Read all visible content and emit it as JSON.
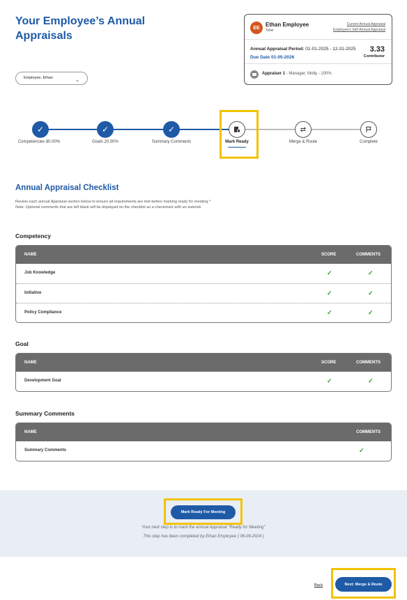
{
  "page": {
    "title": "Your Employee’s Annual Appraisals"
  },
  "employee": {
    "initials": "EE",
    "name": "Ethan Employee",
    "role": "Teller",
    "link_current": "Current Annual Appraisal",
    "link_self": "Employee’s Self-Annual Appraisal",
    "period_label": "Annual Appraisal Period:",
    "period_value": "01-01-2025 - 12-31-2025",
    "due": "Due Date 01-05-2026",
    "score": "3.33",
    "score_label": "Contributor",
    "appraiser_label": "Appraiser 1",
    "appraiser_value": " - Manager, Molly - 100%"
  },
  "employee_select": {
    "value": "Employee, Ethan"
  },
  "stepper": {
    "steps": [
      {
        "label": "Competencies 80.00%",
        "state": "done"
      },
      {
        "label": "Goals 20.00%",
        "state": "done"
      },
      {
        "label": "Summary Comments",
        "state": "done"
      },
      {
        "label": "Mark Ready",
        "state": "active"
      },
      {
        "label": "Merge & Route",
        "state": "upcoming"
      },
      {
        "label": "Complete",
        "state": "upcoming"
      }
    ]
  },
  "checklist": {
    "title": "Annual Appraisal Checklist",
    "description": "Review each annual Appraisal section below to ensure all requirements are met before marking ready for meeting.*",
    "note": "Note: Optional comments that are left blank will be displayed on the checklist as a checkmark with an asterisk."
  },
  "competency": {
    "title": "Competency",
    "headers": {
      "name": "NAME",
      "score": "SCORE",
      "comments": "COMMENTS"
    },
    "rows": [
      {
        "name": "Job Knowledge",
        "score": "✓",
        "comments": "✓"
      },
      {
        "name": "Initiative",
        "score": "✓",
        "comments": "✓"
      },
      {
        "name": "Policy Compliance",
        "score": "✓",
        "comments": "✓"
      }
    ]
  },
  "goal": {
    "title": "Goal",
    "headers": {
      "name": "NAME",
      "score": "SCORE",
      "comments": "COMMENTS"
    },
    "rows": [
      {
        "name": "Development Goal",
        "score": "✓",
        "comments": "✓"
      }
    ]
  },
  "summary": {
    "title": "Summary Comments",
    "headers": {
      "name": "NAME",
      "comments": "COMMENTS"
    },
    "rows": [
      {
        "name": "Summary Comments",
        "comments": "✓"
      }
    ]
  },
  "footer": {
    "mark_ready_button": "Mark Ready For Meeting",
    "message1": "Your next step is to mark the annual Appraisal \"Ready for Meeting\"",
    "message2": "This step has been completed by Ethan Employee ( 06-09-2024 )"
  },
  "nav": {
    "back": "Back",
    "next": "Next: Merge & Route"
  },
  "colors": {
    "accent": "#1f5aa6",
    "highlight": "#f2c200",
    "check": "#2c9a2c",
    "avatar": "#d4551f"
  }
}
